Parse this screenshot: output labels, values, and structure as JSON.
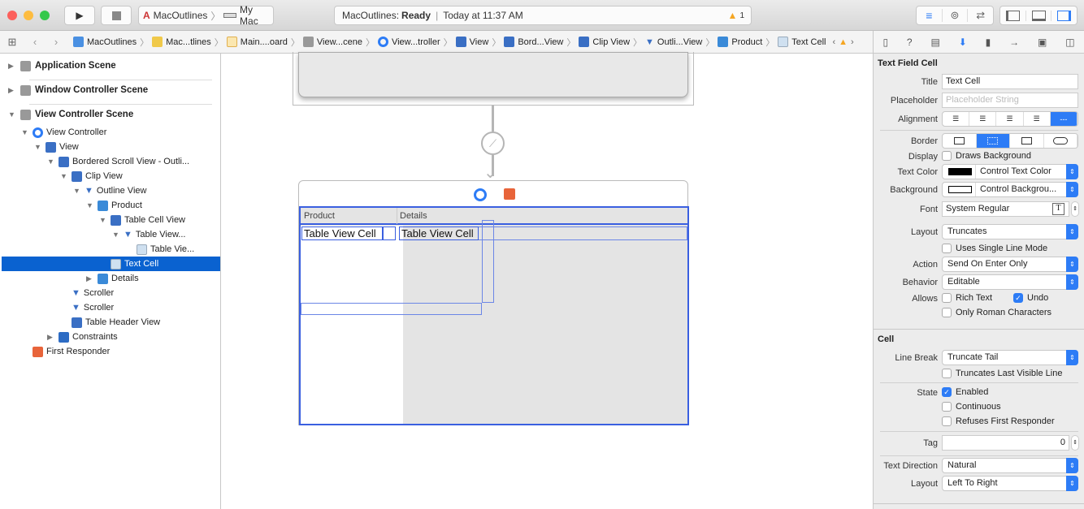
{
  "toolbar": {
    "scheme": "MacOutlines",
    "destination": "My Mac",
    "status_app": "MacOutlines:",
    "status_state": "Ready",
    "status_time": "Today at 11:37 AM",
    "warnings": "1",
    "colors": {
      "close": "#fc605c",
      "min": "#fdbc40",
      "max": "#34c84a",
      "accent": "#2d7cf6"
    }
  },
  "jumpbar": {
    "crumbs": [
      "MacOutlines",
      "Mac...tlines",
      "Main....oard",
      "View...cene",
      "View...troller",
      "View",
      "Bord...View",
      "Clip View",
      "Outli...View",
      "Product",
      "Text Cell"
    ]
  },
  "navigator": {
    "scenes": [
      "Application Scene",
      "Window Controller Scene",
      "View Controller Scene"
    ],
    "items": [
      "View Controller",
      "View",
      "Bordered Scroll View - Outli...",
      "Clip View",
      "Outline View",
      "Product",
      "Table Cell View",
      "Table View...",
      "Table Vie...",
      "Text Cell",
      "Details",
      "Scroller",
      "Scroller",
      "Table Header View",
      "Constraints",
      "First Responder"
    ]
  },
  "canvas": {
    "columns": [
      "Product",
      "Details"
    ],
    "cells": [
      "Table View Cell",
      "Table View Cell"
    ]
  },
  "inspector": {
    "section1": "Text Field Cell",
    "title_label": "Title",
    "title_value": "Text Cell",
    "placeholder_label": "Placeholder",
    "placeholder_hint": "Placeholder String",
    "alignment_label": "Alignment",
    "border_label": "Border",
    "display_label": "Display",
    "draws_background": "Draws Background",
    "text_color_label": "Text Color",
    "text_color": "Control Text Color",
    "background_label": "Background",
    "background": "Control Backgrou...",
    "font_label": "Font",
    "font": "System Regular",
    "layout_label": "Layout",
    "layout": "Truncates",
    "single_line": "Uses Single Line Mode",
    "action_label": "Action",
    "action": "Send On Enter Only",
    "behavior_label": "Behavior",
    "behavior": "Editable",
    "allows_label": "Allows",
    "rich_text": "Rich Text",
    "undo": "Undo",
    "roman": "Only Roman Characters",
    "section2": "Cell",
    "line_break_label": "Line Break",
    "line_break": "Truncate Tail",
    "truncates_last": "Truncates Last Visible Line",
    "state_label": "State",
    "enabled": "Enabled",
    "continuous": "Continuous",
    "refuses": "Refuses First Responder",
    "tag_label": "Tag",
    "tag": "0",
    "text_direction_label": "Text Direction",
    "text_direction": "Natural",
    "layout2_label": "Layout",
    "layout2": "Left To Right"
  }
}
